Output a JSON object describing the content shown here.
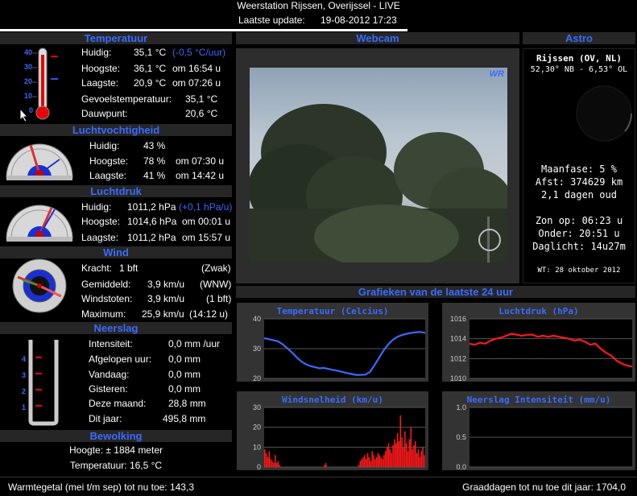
{
  "top": {
    "title": "Weerstation Rijssen, Overijssel - LIVE",
    "update_label": "Laatste update:",
    "update_value": "19-08-2012 17:23"
  },
  "temperatuur": {
    "header": "Temperatuur",
    "scale": [
      "40",
      "30",
      "20",
      "10",
      "0"
    ],
    "huidig_label": "Huidig:",
    "huidig_value": "35,1 °C",
    "huidig_trend": "(-0,5 °C/uur)",
    "hoogste_label": "Hoogste:",
    "hoogste_value": "36,1 °C",
    "hoogste_time": "om 16:54 u",
    "laagste_label": "Laagste:",
    "laagste_value": "20,9 °C",
    "laagste_time": "om 07:26 u",
    "gevoel_label": "Gevoelstemperatuur:",
    "gevoel_value": "35,1 °C",
    "dauw_label": "Dauwpunt:",
    "dauw_value": "20,6 °C"
  },
  "vocht": {
    "header": "Luchtvochtigheid",
    "huidig_label": "Huidig:",
    "huidig_value": "43 %",
    "hoogste_label": "Hoogste:",
    "hoogste_value": "78 %",
    "hoogste_time": "om 07:30 u",
    "laagste_label": "Laagste:",
    "laagste_value": "41 %",
    "laagste_time": "om 14:42 u"
  },
  "druk": {
    "header": "Luchtdruk",
    "huidig_label": "Huidig:",
    "huidig_value": "1011,2 hPa",
    "huidig_trend": "(+0,1 hPa/u)",
    "hoogste_label": "Hoogste:",
    "hoogste_value": "1014,6 hPa",
    "hoogste_time": "om 00:01 u",
    "laagste_label": "Laagste:",
    "laagste_value": "1011,2 hPa",
    "laagste_time": "om 15:57 u"
  },
  "wind": {
    "header": "Wind",
    "kracht_label": "Kracht:",
    "kracht_value": "1 bft",
    "kracht_extra": "(Zwak)",
    "gem_label": "Gemiddeld:",
    "gem_value": "3,9 km/u",
    "gem_extra": "(WNW)",
    "stoot_label": "Windstoten:",
    "stoot_value": "3,9 km/u",
    "stoot_extra": "(1 bft)",
    "max_label": "Maximum:",
    "max_value": "25,9 km/u",
    "max_extra": "(14:12 u)"
  },
  "neerslag": {
    "header": "Neerslag",
    "scale": [
      "4",
      "3",
      "2",
      "1"
    ],
    "int_label": "Intensiteit:",
    "int_value": "0,0 mm /uur",
    "uur_label": "Afgelopen uur:",
    "uur_value": "0,0 mm",
    "vandaag_label": "Vandaag:",
    "vandaag_value": "0,0 mm",
    "gisteren_label": "Gisteren:",
    "gisteren_value": "0,0 mm",
    "maand_label": "Deze maand:",
    "maand_value": "28,8 mm",
    "jaar_label": "Dit jaar:",
    "jaar_value": "495,8 mm"
  },
  "bewolking": {
    "header": "Bewolking",
    "hoogte": "Hoogte: ± 1884 meter",
    "temp": "Temperatuur: 16,5 °C"
  },
  "webcam": {
    "header": "Webcam",
    "logo": "WR"
  },
  "astro": {
    "header": "Astro",
    "place": "Rijssen (OV, NL)",
    "coords": "52,30° NB - 6,53° OL",
    "maanfase": "Maanfase: 5 %",
    "afstand": "Afst: 374629 km",
    "dagen": "2,1 dagen oud",
    "zon_op": "Zon op: 06:23 u",
    "onder": "Onder: 20:51 u",
    "daglicht": "Daglicht: 14u27m",
    "credit": "WT: 28 oktober 2012"
  },
  "grafieken": {
    "header": "Grafieken van de laatste 24 uur"
  },
  "charts": {
    "temp": {
      "title": "Temperatuur (Celcius)",
      "ticks": [
        "40",
        "30",
        "20"
      ]
    },
    "druk": {
      "title": "Luchtdruk (hPa)",
      "ticks": [
        "1016",
        "1014",
        "1012",
        "1010"
      ]
    },
    "wind": {
      "title": "Windsnelheid (km/u)",
      "ticks": [
        "30",
        "20",
        "10",
        "0"
      ]
    },
    "neerslag": {
      "title": "Neerslag Intensiteit (mm/u)",
      "ticks": [
        "1.0",
        "0.5",
        "0.0"
      ]
    }
  },
  "footer": {
    "left": "Warmtegetal (mei t/m sep) tot nu toe: 143,3",
    "right": "Graaddagen tot nu toe dit jaar: 1704,0"
  },
  "chart_data": [
    {
      "type": "line",
      "title": "Temperatuur (Celcius)",
      "ylim": [
        20,
        40
      ],
      "color": "#3a6bff",
      "values": [
        33.5,
        33.2,
        32.8,
        32.5,
        31.5,
        30.2,
        28.8,
        27.2,
        25.8,
        24.8,
        24.2,
        23.8,
        23.4,
        23.5,
        23.2,
        22.8,
        22.6,
        22.2,
        21.8,
        21.5,
        21.2,
        21.2,
        21.3,
        22.2,
        24.5,
        27.0,
        29.5,
        31.5,
        33.0,
        34.0,
        34.6,
        35.0,
        35.3,
        35.5,
        35.6,
        35.3
      ]
    },
    {
      "type": "line",
      "title": "Luchtdruk (hPa)",
      "ylim": [
        1010,
        1016
      ],
      "color": "#ff1a1a",
      "values": [
        1013.5,
        1013.4,
        1013.6,
        1013.5,
        1013.8,
        1014.0,
        1014.1,
        1014.3,
        1014.5,
        1014.4,
        1014.3,
        1014.4,
        1014.4,
        1014.2,
        1014.3,
        1014.2,
        1014.3,
        1014.2,
        1014.1,
        1014.0,
        1013.8,
        1013.9,
        1013.7,
        1013.4,
        1013.5,
        1013.0,
        1012.6,
        1012.3,
        1011.8,
        1011.5,
        1011.3,
        1011.2
      ]
    },
    {
      "type": "bar",
      "title": "Windsnelheid (km/u)",
      "ylim": [
        0,
        30
      ],
      "color": "#ff1a1a",
      "values": [
        9,
        7,
        5,
        8,
        4,
        3,
        2,
        6,
        2,
        3,
        1,
        0,
        0,
        0,
        0,
        0,
        0,
        0,
        0,
        0,
        0,
        0,
        0,
        0,
        0,
        0,
        0,
        0,
        0,
        0,
        0,
        0,
        0,
        0,
        0,
        0,
        0,
        0,
        0,
        0,
        1,
        2,
        0,
        0,
        0,
        0,
        0,
        0,
        0,
        0,
        0,
        0,
        0,
        0,
        0,
        0,
        0,
        0,
        0,
        0,
        0,
        0,
        0,
        1,
        3,
        4,
        5,
        6,
        4,
        7,
        5,
        3,
        8,
        6,
        4,
        5,
        7,
        6,
        5,
        4,
        6,
        8,
        10,
        12,
        9,
        7,
        11,
        14,
        12,
        17,
        13,
        26,
        15,
        10,
        18,
        12,
        8,
        14,
        20,
        9,
        11,
        13,
        7,
        9,
        5,
        8,
        10,
        6
      ]
    },
    {
      "type": "line",
      "title": "Neerslag Intensiteit (mm/u)",
      "ylim": [
        0,
        1
      ],
      "color": "#ff1a1a",
      "values": []
    }
  ]
}
